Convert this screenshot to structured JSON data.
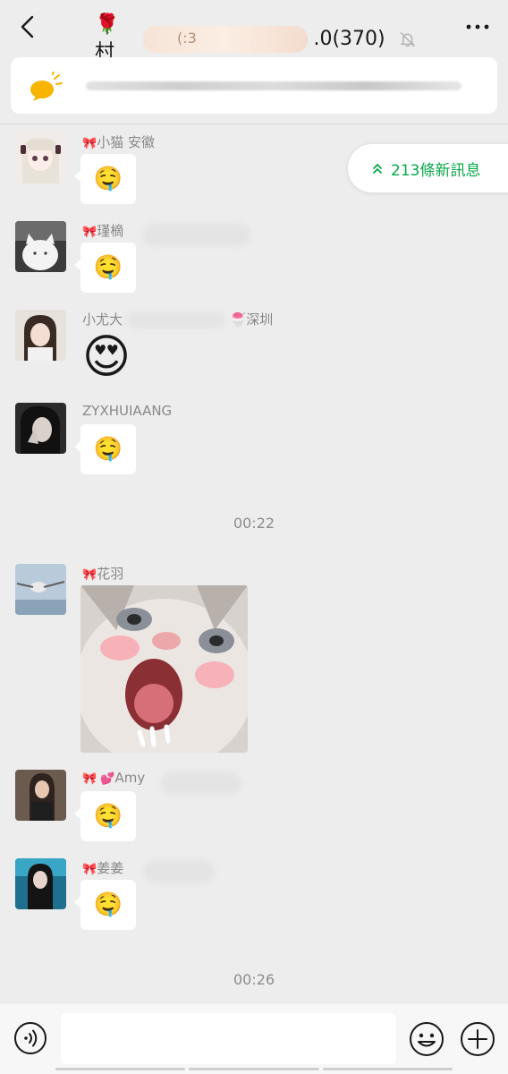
{
  "header": {
    "title_prefix": "🌹村",
    "title_suffix": ".0(370)",
    "back_icon": "chevron-left-icon",
    "mute_icon": "bell-slash-icon",
    "more_icon": "more-dots-icon"
  },
  "notice": {
    "icon": "speech-bubble-icon",
    "color": "#f7b500"
  },
  "new_messages": {
    "label": "213條新訊息",
    "color": "#07a848"
  },
  "messages": [
    {
      "sender_prefix": "🎀",
      "sender": "小猫 安徽",
      "emoji": "🤤"
    },
    {
      "sender_prefix": "🎀",
      "sender": "瑾樀",
      "emoji": "🤤"
    },
    {
      "sender_prefix": "",
      "sender": "小尤大",
      "sender_tail": "🍧深圳",
      "emoji": "😍"
    },
    {
      "sender_prefix": "",
      "sender": "ZYXHUIAANG",
      "emoji": "🤤"
    },
    {
      "sender_prefix": "🎀",
      "sender": "花羽",
      "emoji": ""
    },
    {
      "sender_prefix": "🎀 💕",
      "sender": "Amy",
      "emoji": "🤤"
    },
    {
      "sender_prefix": "🎀",
      "sender": "姜姜",
      "emoji": "🤤"
    }
  ],
  "timestamps": [
    "00:22",
    "00:26"
  ],
  "bottom": {
    "voice_icon": "voice-icon",
    "emoji_icon": "smiley-icon",
    "plus_icon": "plus-circle-icon",
    "input_value": ""
  }
}
